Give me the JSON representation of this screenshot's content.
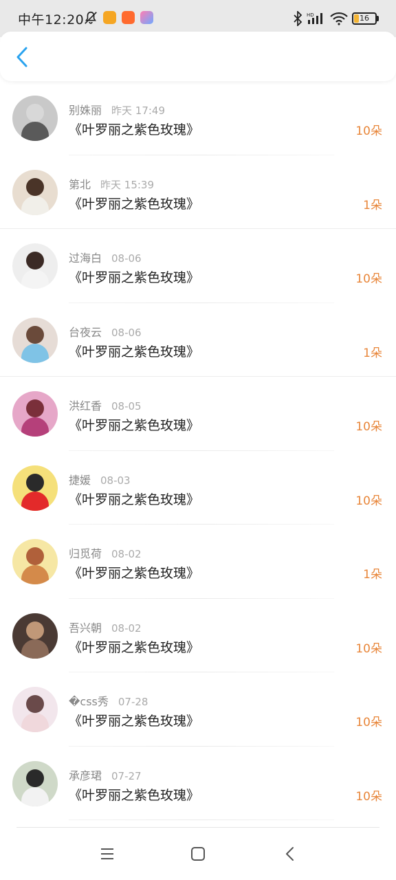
{
  "status_bar": {
    "time": "中午12:20",
    "battery": "16",
    "icons": [
      "mute-bell-icon",
      "weibo-icon",
      "taobao-icon",
      "game-app-icon",
      "bluetooth-icon",
      "hd-signal-icon",
      "wifi-icon",
      "battery-icon"
    ],
    "colors": {
      "weibo": "#f5a623",
      "taobao": "#ff6a2e",
      "game": "#6fa8ff"
    }
  },
  "header": {
    "back_icon": "chevron-left-icon",
    "accent": "#2aa3ef"
  },
  "gifts": [
    {
      "name": "别姝丽",
      "time": "昨天 17:49",
      "item": "《叶罗丽之紫色玫瑰》",
      "count": "10朵",
      "avatar": {
        "bg": "#c9c9c9",
        "fg": "#5a5a5a",
        "head": "#d8d8d8"
      }
    },
    {
      "name": "第北",
      "time": "昨天 15:39",
      "item": "《叶罗丽之紫色玫瑰》",
      "count": "1朵",
      "avatar": {
        "bg": "#e8ddd0",
        "fg": "#f1efe9",
        "head": "#4a3428"
      }
    },
    {
      "name": "过海白",
      "time": "08-06",
      "item": "《叶罗丽之紫色玫瑰》",
      "count": "10朵",
      "avatar": {
        "bg": "#eeeeee",
        "fg": "#f4f4f4",
        "head": "#3b2a25"
      }
    },
    {
      "name": "台夜云",
      "time": "08-06",
      "item": "《叶罗丽之紫色玫瑰》",
      "count": "1朵",
      "avatar": {
        "bg": "#e6dcd6",
        "fg": "#7fc3e6",
        "head": "#6a4a3a"
      }
    },
    {
      "name": "洪红香",
      "time": "08-05",
      "item": "《叶罗丽之紫色玫瑰》",
      "count": "10朵",
      "avatar": {
        "bg": "#e6a7c8",
        "fg": "#b5407a",
        "head": "#7a2f3a"
      }
    },
    {
      "name": "捷媛",
      "time": "08-03",
      "item": "《叶罗丽之紫色玫瑰》",
      "count": "10朵",
      "avatar": {
        "bg": "#f5e07a",
        "fg": "#e32a2a",
        "head": "#2a2a2a"
      }
    },
    {
      "name": "归觅荷",
      "time": "08-02",
      "item": "《叶罗丽之紫色玫瑰》",
      "count": "1朵",
      "avatar": {
        "bg": "#f6e7a4",
        "fg": "#d48a4a",
        "head": "#b0603a"
      }
    },
    {
      "name": "吾兴朝",
      "time": "08-02",
      "item": "《叶罗丽之紫色玫瑰》",
      "count": "10朵",
      "avatar": {
        "bg": "#4a3a34",
        "fg": "#8a6a58",
        "head": "#c09878"
      }
    },
    {
      "name": "�css秀",
      "time": "07-28",
      "item": "《叶罗丽之紫色玫瑰》",
      "count": "10朵",
      "avatar": {
        "bg": "#f2e6ec",
        "fg": "#f0d8dc",
        "head": "#6a4a4a"
      }
    },
    {
      "name": "承彦珺",
      "time": "07-27",
      "item": "《叶罗丽之紫色玫瑰》",
      "count": "10朵",
      "avatar": {
        "bg": "#cfd9c8",
        "fg": "#f2f2f2",
        "head": "#2a2a2a"
      }
    }
  ],
  "nav_bar": {
    "icons": [
      "menu-icon",
      "home-square-icon",
      "back-chevron-icon"
    ]
  }
}
